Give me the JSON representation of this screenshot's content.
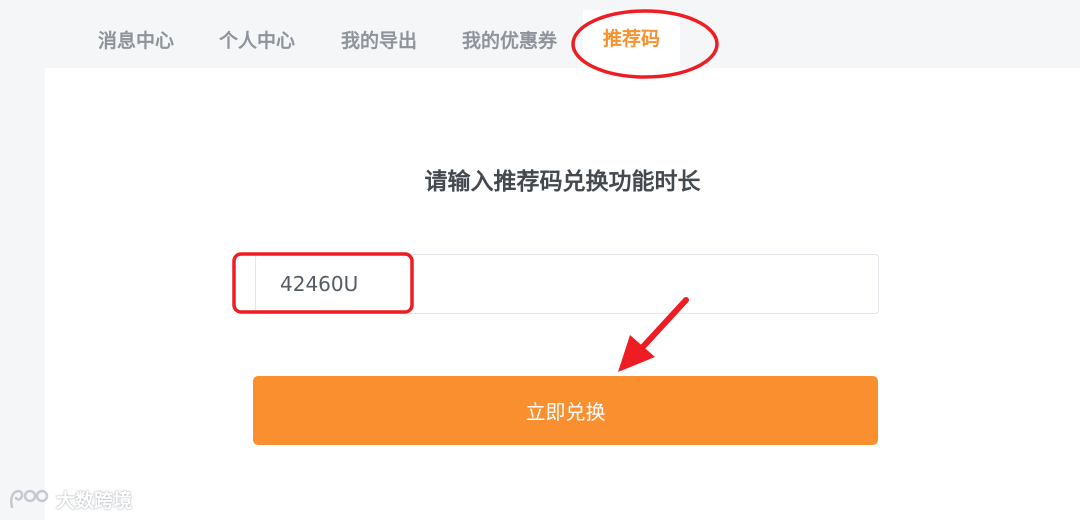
{
  "tabs": [
    {
      "label": "消息中心",
      "active": false
    },
    {
      "label": "个人中心",
      "active": false
    },
    {
      "label": "我的导出",
      "active": false
    },
    {
      "label": "我的优惠券",
      "active": false
    },
    {
      "label": "推荐码",
      "active": true
    }
  ],
  "main": {
    "heading": "请输入推荐码兑换功能时长",
    "code_input": {
      "value": "42460U",
      "placeholder": ""
    },
    "redeem_button": "立即兑换"
  },
  "watermark": {
    "text": "大数跨境",
    "icon": "brand-logo-icon"
  },
  "colors": {
    "accent": "#fa8f30",
    "active_tab": "#f7922e",
    "annotation": "#ee1d23"
  }
}
